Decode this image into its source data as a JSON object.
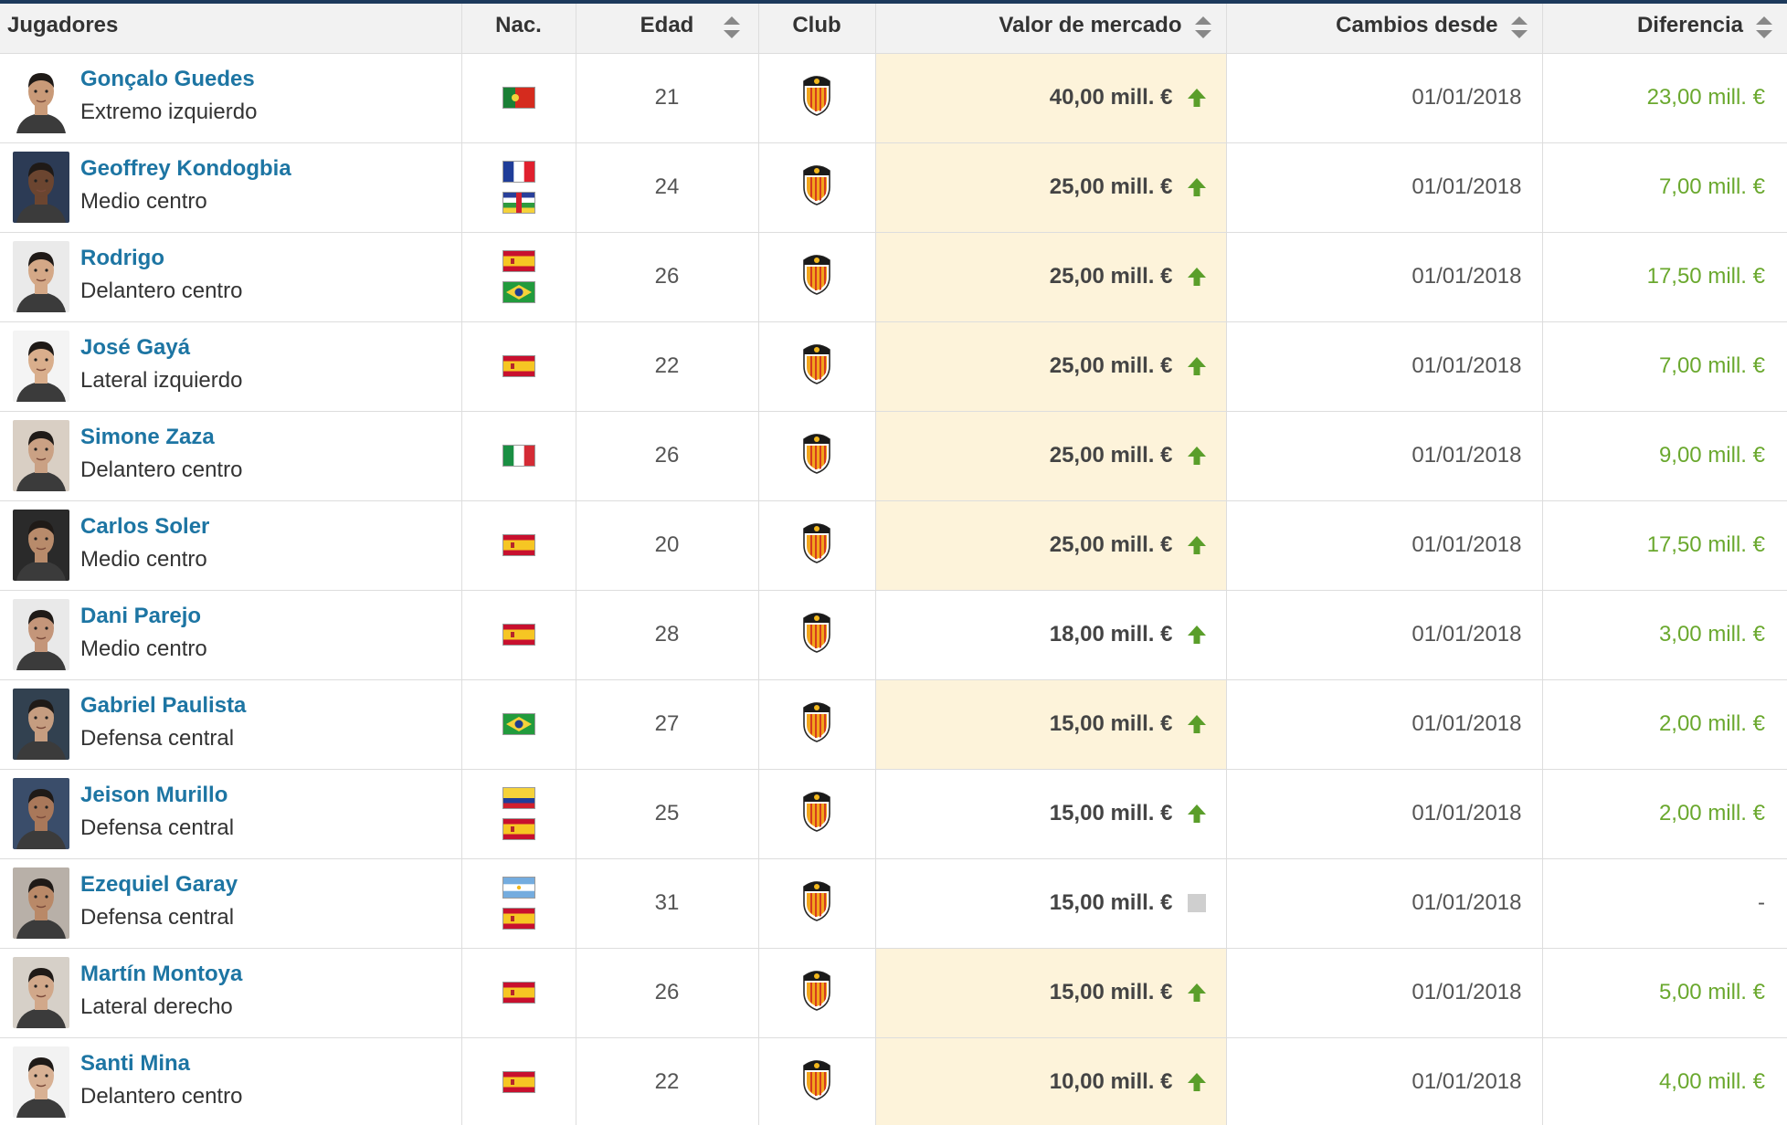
{
  "colors": {
    "link": "#1d75a3",
    "positive": "#6aa82e",
    "highlight": "#fdf3da",
    "header_bg": "#f2f2f2",
    "trend_up": "#5a9e2a",
    "trend_neutral": "#cfcfcf"
  },
  "table": {
    "headers": {
      "player": "Jugadores",
      "nationality": "Nac.",
      "age": "Edad",
      "club": "Club",
      "market_value": "Valor de mercado",
      "changed_since": "Cambios desde",
      "difference": "Diferencia"
    },
    "rows": [
      {
        "name": "Gonçalo Guedes",
        "position": "Extremo izquierdo",
        "flags": [
          "portugal"
        ],
        "age": "21",
        "club_icon": "valencia-crest-icon",
        "value": "40,00 mill. €",
        "trend": "up",
        "highlight": true,
        "since": "01/01/2018",
        "diff": "23,00 mill. €"
      },
      {
        "name": "Geoffrey Kondogbia",
        "position": "Medio centro",
        "flags": [
          "france",
          "central-african-republic"
        ],
        "age": "24",
        "club_icon": "valencia-crest-icon",
        "value": "25,00 mill. €",
        "trend": "up",
        "highlight": true,
        "since": "01/01/2018",
        "diff": "7,00 mill. €"
      },
      {
        "name": "Rodrigo",
        "position": "Delantero centro",
        "flags": [
          "spain",
          "brazil"
        ],
        "age": "26",
        "club_icon": "valencia-crest-icon",
        "value": "25,00 mill. €",
        "trend": "up",
        "highlight": true,
        "since": "01/01/2018",
        "diff": "17,50 mill. €"
      },
      {
        "name": "José Gayá",
        "position": "Lateral izquierdo",
        "flags": [
          "spain"
        ],
        "age": "22",
        "club_icon": "valencia-crest-icon",
        "value": "25,00 mill. €",
        "trend": "up",
        "highlight": true,
        "since": "01/01/2018",
        "diff": "7,00 mill. €"
      },
      {
        "name": "Simone Zaza",
        "position": "Delantero centro",
        "flags": [
          "italy"
        ],
        "age": "26",
        "club_icon": "valencia-crest-icon",
        "value": "25,00 mill. €",
        "trend": "up",
        "highlight": true,
        "since": "01/01/2018",
        "diff": "9,00 mill. €"
      },
      {
        "name": "Carlos Soler",
        "position": "Medio centro",
        "flags": [
          "spain"
        ],
        "age": "20",
        "club_icon": "valencia-crest-icon",
        "value": "25,00 mill. €",
        "trend": "up",
        "highlight": true,
        "since": "01/01/2018",
        "diff": "17,50 mill. €"
      },
      {
        "name": "Dani Parejo",
        "position": "Medio centro",
        "flags": [
          "spain"
        ],
        "age": "28",
        "club_icon": "valencia-crest-icon",
        "value": "18,00 mill. €",
        "trend": "up",
        "highlight": false,
        "since": "01/01/2018",
        "diff": "3,00 mill. €"
      },
      {
        "name": "Gabriel Paulista",
        "position": "Defensa central",
        "flags": [
          "brazil"
        ],
        "age": "27",
        "club_icon": "valencia-crest-icon",
        "value": "15,00 mill. €",
        "trend": "up",
        "highlight": true,
        "since": "01/01/2018",
        "diff": "2,00 mill. €"
      },
      {
        "name": "Jeison Murillo",
        "position": "Defensa central",
        "flags": [
          "colombia",
          "spain"
        ],
        "age": "25",
        "club_icon": "valencia-crest-icon",
        "value": "15,00 mill. €",
        "trend": "up",
        "highlight": false,
        "since": "01/01/2018",
        "diff": "2,00 mill. €"
      },
      {
        "name": "Ezequiel Garay",
        "position": "Defensa central",
        "flags": [
          "argentina",
          "spain"
        ],
        "age": "31",
        "club_icon": "valencia-crest-icon",
        "value": "15,00 mill. €",
        "trend": "neutral",
        "highlight": false,
        "since": "01/01/2018",
        "diff": "-"
      },
      {
        "name": "Martín Montoya",
        "position": "Lateral derecho",
        "flags": [
          "spain"
        ],
        "age": "26",
        "club_icon": "valencia-crest-icon",
        "value": "15,00 mill. €",
        "trend": "up",
        "highlight": true,
        "since": "01/01/2018",
        "diff": "5,00 mill. €"
      },
      {
        "name": "Santi Mina",
        "position": "Delantero centro",
        "flags": [
          "spain"
        ],
        "age": "22",
        "club_icon": "valencia-crest-icon",
        "value": "10,00 mill. €",
        "trend": "up",
        "highlight": true,
        "since": "01/01/2018",
        "diff": "4,00 mill. €"
      }
    ]
  }
}
